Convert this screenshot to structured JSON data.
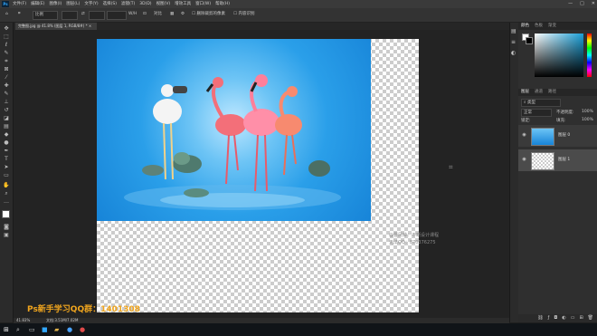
{
  "app": {
    "logo": "Ps"
  },
  "menu": [
    "文件(F)",
    "编辑(E)",
    "图像(I)",
    "图层(L)",
    "文字(Y)",
    "选择(S)",
    "滤镜(T)",
    "3D(D)",
    "视图(V)",
    "增效工具",
    "窗口(W)",
    "帮助(H)"
  ],
  "window_controls": [
    "—",
    "□",
    "✕"
  ],
  "options": {
    "tool_select": "比例",
    "rotate": "0.00",
    "reset_label": "拖移",
    "extra": "W/H",
    "alignment": "对比",
    "checkbox_label": "删除裁剪的像素",
    "content_aware": "内容识别"
  },
  "document_tab": {
    "title": "完整图.jpg @ 41.8% (图层 1, RGB/8#) *",
    "close": "×"
  },
  "status": {
    "zoom": "41.83%",
    "info": "文档:3.51M/7.02M"
  },
  "watermark": {
    "qq_text": "Ps新手学习QQ群：1401308",
    "line1": "@曹凤钟：不断设计课程",
    "line2": "无法QQ：870376275"
  },
  "panels": {
    "top_tabs": [
      "颜色",
      "色板",
      "渐变"
    ],
    "layers_tabs": [
      "图层",
      "通道",
      "路径"
    ],
    "blend_mode": "正常",
    "opacity_label": "不透明度:",
    "opacity": "100%",
    "lock_label": "锁定:",
    "fill_label": "填充:",
    "fill": "100%",
    "kind_label": "类型"
  },
  "layers": [
    {
      "name": "图层 0",
      "visible": true
    },
    {
      "name": "图层 1",
      "visible": true
    }
  ],
  "colors": {
    "accent": "#31a8ff",
    "background": "#1f1f1f",
    "panel": "#2f2f2f",
    "qq_text": "#f0a51e",
    "sky": "#2a9fe9"
  },
  "icons": {
    "move": "move-icon",
    "marquee": "marquee-icon",
    "lasso": "lasso-icon",
    "crop": "crop-icon",
    "brush": "brush-icon",
    "eraser": "eraser-icon",
    "type": "type-icon",
    "hand": "hand-icon",
    "zoom": "zoom-icon"
  }
}
